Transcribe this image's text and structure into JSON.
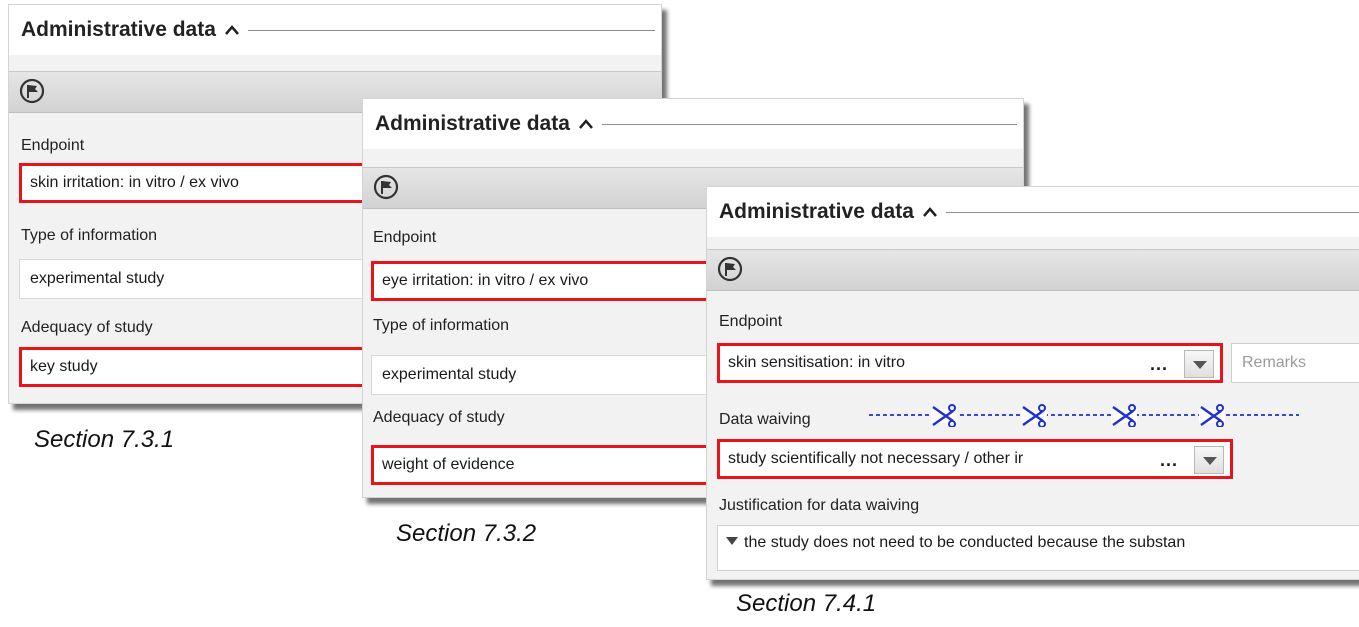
{
  "panels": [
    {
      "title": "Administrative data",
      "endpoint_label": "Endpoint",
      "endpoint_value": "skin irritation: in vitro / ex vivo",
      "type_label": "Type of information",
      "type_value": "experimental study",
      "adequacy_label": "Adequacy of study",
      "adequacy_value": "key study"
    },
    {
      "title": "Administrative data",
      "endpoint_label": "Endpoint",
      "endpoint_value": "eye irritation: in vitro / ex vivo",
      "type_label": "Type of information",
      "type_value": "experimental study",
      "adequacy_label": "Adequacy of study",
      "adequacy_value": "weight of evidence"
    },
    {
      "title": "Administrative data",
      "endpoint_label": "Endpoint",
      "endpoint_value": "skin sensitisation:  in vitro",
      "endpoint_ellipsis": "...",
      "remarks_placeholder": "Remarks",
      "waiving_label": "Data waiving",
      "waiving_value": "study scientifically not necessary / other ir",
      "waiving_ellipsis": "...",
      "justification_label": "Justification for data waiving",
      "justification_value": "the study does not need to be conducted because the substan"
    }
  ],
  "captions": [
    "Section 7.3.1",
    "Section 7.3.2",
    "Section 7.4.1"
  ],
  "colors": {
    "highlight": "#e8141c",
    "scissor_line": "#1f2fd6",
    "panel_bg": "#f2f2f2"
  },
  "icons": {
    "flag": "flag-circle-icon",
    "collapse": "caret-up-icon",
    "dropdown": "triangle-down-icon",
    "scissors": "scissors-icon"
  }
}
